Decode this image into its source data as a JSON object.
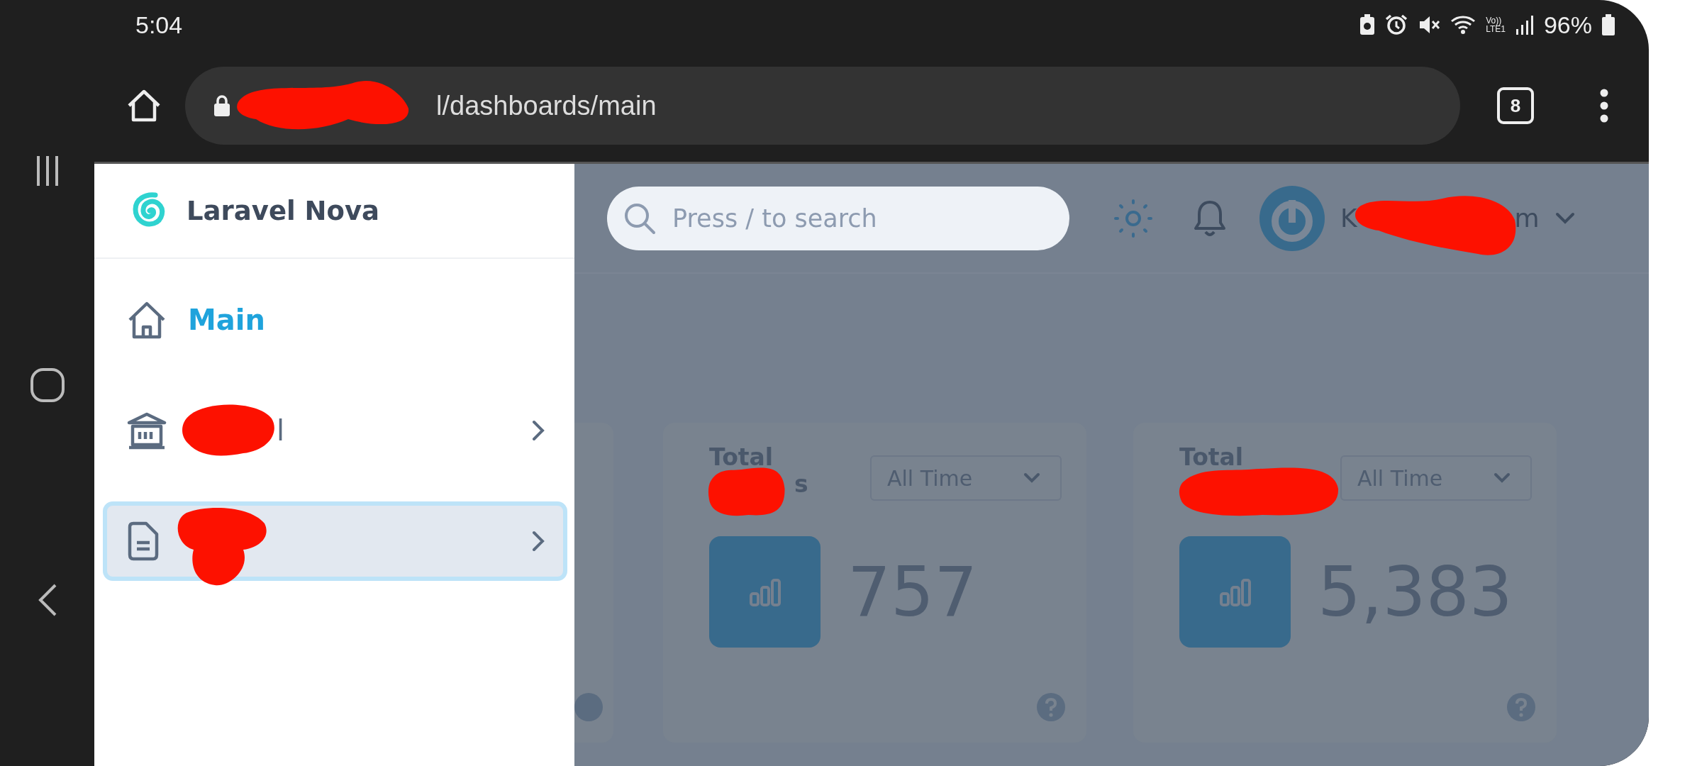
{
  "status_bar": {
    "time": "5:04",
    "volte_top": "Vo))",
    "volte_bottom": "LTE1",
    "battery": "96%"
  },
  "browser": {
    "url": "l/dashboards/main",
    "tab_count": "8"
  },
  "sidebar": {
    "brand": "Laravel Nova",
    "items": [
      {
        "label": "Main",
        "selected": true,
        "focused": false,
        "expandable": false,
        "redacted": false
      },
      {
        "label": "l",
        "selected": false,
        "focused": false,
        "expandable": true,
        "redacted": true
      },
      {
        "selected": false,
        "focused": true,
        "expandable": true,
        "redacted": true
      }
    ]
  },
  "header": {
    "search_placeholder": "Press / to search",
    "user_name_start": "K",
    "user_name_end": "m",
    "redacted": true
  },
  "cards": [
    {
      "kind": "clipped"
    },
    {
      "kind": "metric",
      "title": "Total",
      "title_fragment": "s",
      "range": "All Time",
      "value": "757",
      "redacted": true
    },
    {
      "kind": "metric",
      "title": "Total",
      "range": "All Time",
      "value": "5,383",
      "redacted": true
    }
  ]
}
